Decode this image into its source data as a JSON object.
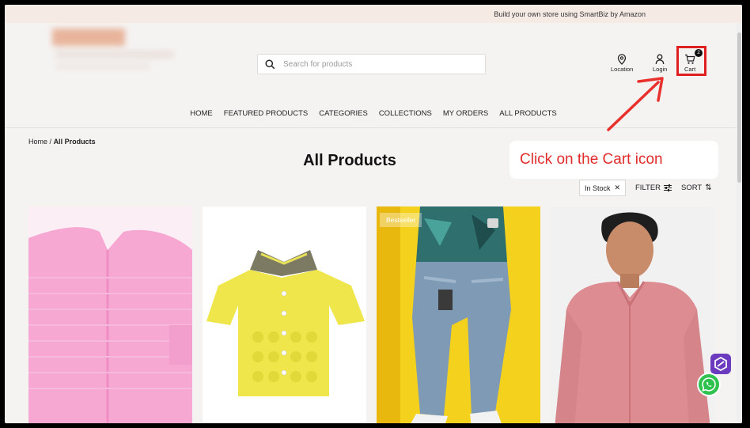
{
  "promo": {
    "text": "Build your own store using SmartBiz by Amazon"
  },
  "search": {
    "placeholder": "Search for products"
  },
  "header": {
    "location_label": "Location",
    "login_label": "Login",
    "cart_label": "Cart",
    "cart_count": "2"
  },
  "nav": {
    "items": [
      "HOME",
      "FEATURED PRODUCTS",
      "CATEGORIES",
      "COLLECTIONS",
      "MY ORDERS",
      "ALL PRODUCTS"
    ]
  },
  "breadcrumb": {
    "home": "Home",
    "separator": "/",
    "current": "All Products"
  },
  "page": {
    "title": "All Products"
  },
  "annotation": {
    "callout": "Click on the Cart icon",
    "color": "#e22d2d"
  },
  "filters": {
    "chip_label": "In Stock",
    "filter_label": "FILTER",
    "sort_label": "SORT"
  },
  "products": [
    {
      "badge": ""
    },
    {
      "badge": ""
    },
    {
      "badge": "Bestseller"
    },
    {
      "badge": ""
    }
  ]
}
